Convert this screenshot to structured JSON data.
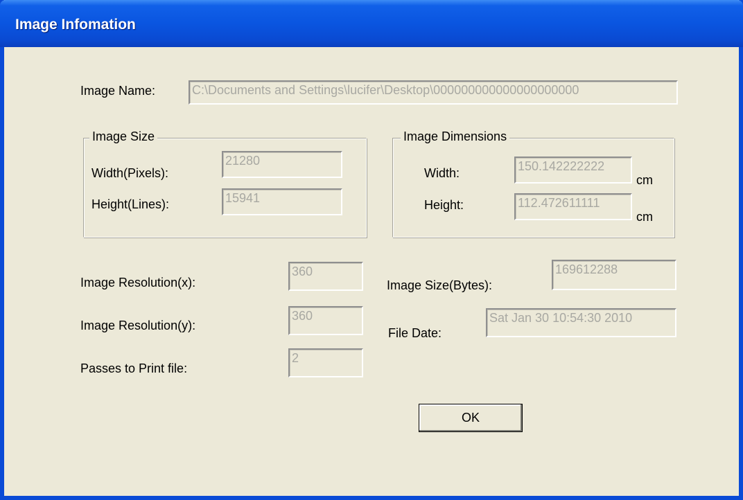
{
  "window": {
    "title": "Image Infomation"
  },
  "image_name": {
    "label": "Image Name:",
    "value": "C:\\Documents and Settings\\lucifer\\Desktop\\000000000000000000000"
  },
  "image_size_group": {
    "caption": "Image Size",
    "width_label": "Width(Pixels):",
    "width_value": "21280",
    "height_label": "Height(Lines):",
    "height_value": "15941"
  },
  "image_dimensions_group": {
    "caption": "Image Dimensions",
    "width_label": "Width:",
    "width_value": "150.142222222",
    "width_unit": "cm",
    "height_label": "Height:",
    "height_value": "112.472611111",
    "height_unit": "cm"
  },
  "resolution": {
    "x_label": "Image Resolution(x):",
    "x_value": "360",
    "y_label": "Image Resolution(y):",
    "y_value": "360",
    "passes_label": "Passes to Print file:",
    "passes_value": "2"
  },
  "file_info": {
    "size_label": "Image Size(Bytes):",
    "size_value": "169612288",
    "date_label": "File Date:",
    "date_value": "Sat Jan 30 10:54:30 2010"
  },
  "buttons": {
    "ok_label": "OK"
  },
  "colors": {
    "titlebar": "#0a55e0",
    "dialog_background": "#ece9d8",
    "disabled_text": "#a8a8a2"
  }
}
